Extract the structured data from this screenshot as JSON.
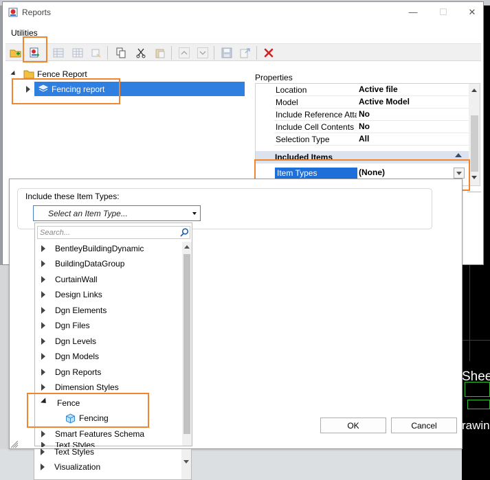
{
  "window": {
    "title": "Reports",
    "menu": "Utilities",
    "controls": {
      "minimize": "—",
      "maximize": "☐",
      "close": "✕"
    }
  },
  "toolbar": {
    "buttons": [
      "new-folder-icon",
      "new-report-icon",
      "columns-icon",
      "table-icon",
      "format-icon",
      "copy-icon",
      "cut-icon",
      "paste-icon",
      "move-up-icon",
      "move-down-icon",
      "save-icon",
      "export-icon",
      "delete-icon"
    ]
  },
  "tree": {
    "root_label": "Fence Report",
    "child_label": "Fencing report"
  },
  "properties": {
    "title": "Properties",
    "rows": [
      {
        "name": "Location",
        "value": "Active file"
      },
      {
        "name": "Model",
        "value": "Active Model"
      },
      {
        "name": "Include Reference Attac",
        "value": "No"
      },
      {
        "name": "Include Cell Contents",
        "value": "No"
      },
      {
        "name": "Selection Type",
        "value": "All"
      }
    ],
    "section_title": "Included Items",
    "item_types_label": "Item Types",
    "item_types_value": "(None)"
  },
  "item_type_dialog": {
    "include_label": "Include these Item Types:",
    "select_placeholder": "Select an Item Type...",
    "search_placeholder": "Search...",
    "items": [
      {
        "label": "BentleyBuildingDynamic",
        "kind": "collapsed"
      },
      {
        "label": "BuildingDataGroup",
        "kind": "collapsed"
      },
      {
        "label": "CurtainWall",
        "kind": "collapsed"
      },
      {
        "label": "Design Links",
        "kind": "collapsed"
      },
      {
        "label": "Dgn Elements",
        "kind": "collapsed"
      },
      {
        "label": "Dgn Files",
        "kind": "collapsed"
      },
      {
        "label": "Dgn Levels",
        "kind": "collapsed"
      },
      {
        "label": "Dgn Models",
        "kind": "collapsed"
      },
      {
        "label": "Dgn Reports",
        "kind": "collapsed"
      },
      {
        "label": "Dimension Styles",
        "kind": "collapsed"
      },
      {
        "label": "Fence",
        "kind": "expanded"
      },
      {
        "label": "Fencing",
        "kind": "leaf"
      },
      {
        "label": "Smart Features Schema",
        "kind": "collapsed"
      },
      {
        "label": "Text Styles",
        "kind": "collapsed"
      },
      {
        "label": "Visualization",
        "kind": "collapsed"
      }
    ],
    "ok_label": "OK",
    "cancel_label": "Cancel"
  },
  "background": {
    "sheet_text": "Shee",
    "drawing_text": "rawin"
  },
  "colors": {
    "selection": "#2f7fe0",
    "highlight": "#f0852e",
    "delete": "#d42020"
  }
}
